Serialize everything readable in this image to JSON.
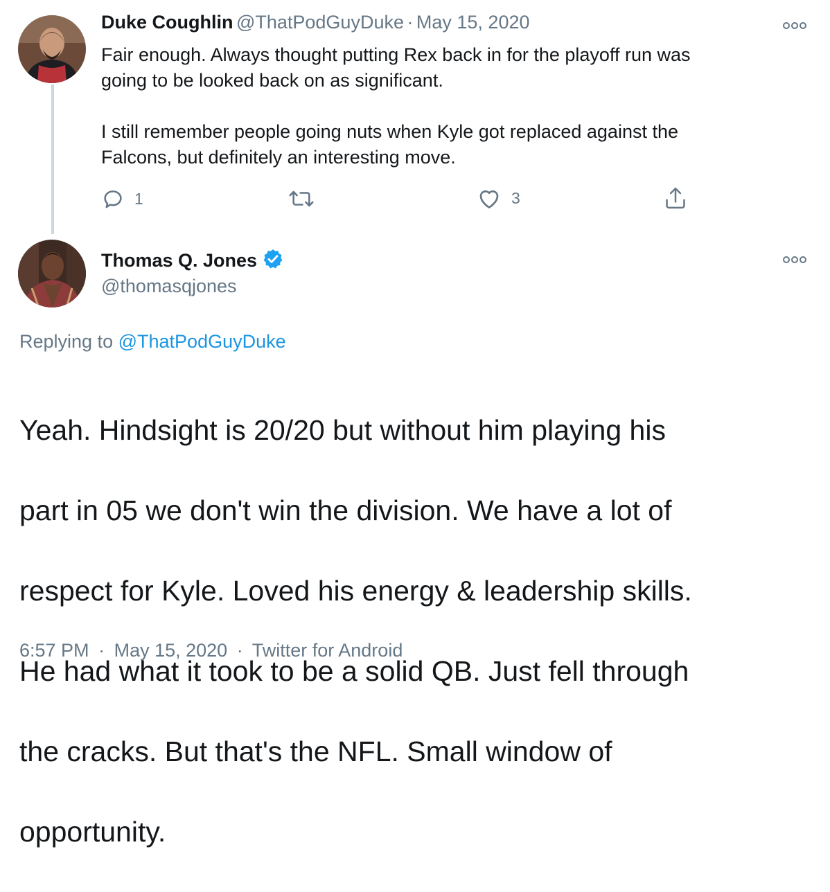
{
  "first_tweet": {
    "display_name": "Duke Coughlin",
    "handle": "@ThatPodGuyDuke",
    "separator": "·",
    "date": "May 15, 2020",
    "text": "Fair enough. Always thought putting Rex back in for the playoff run was going to be looked back on as significant.\n\nI still remember people going nuts when Kyle got replaced against the Falcons, but definitely an interesting move.",
    "line1": "Fair enough. Always thought putting Rex back in for the playoff run was",
    "line2": "going to be looked back on as significant.",
    "line3": "I still remember people going nuts when Kyle got replaced against the",
    "line4": "Falcons, but definitely an interesting move.",
    "reply_count": "1",
    "retweet_count": "",
    "like_count": "3",
    "icons": [
      "reply-icon",
      "retweet-icon",
      "like-icon",
      "share-icon",
      "more-icon"
    ]
  },
  "main_tweet": {
    "display_name": "Thomas Q. Jones",
    "verified": true,
    "handle": "@thomasqjones",
    "replying_prefix": "Replying to",
    "replying_handle": "@ThatPodGuyDuke",
    "text_lines": [
      "Yeah. Hindsight is 20/20 but without him playing his",
      "part in 05 we don't win the division. We have a lot of",
      "respect for Kyle. Loved his energy & leadership skills.",
      "He had what it took to be a solid QB. Just fell through",
      "the cracks. But that's the NFL. Small window of",
      "opportunity."
    ],
    "time": "6:57 PM",
    "separator1": "·",
    "date": "May 15, 2020",
    "separator2": "·",
    "source": "Twitter for Android"
  },
  "colors": {
    "text": "#14171a",
    "muted": "#657786",
    "link": "#1b95e0",
    "verified": "#1da1f2",
    "thread_line": "#ccd6dd"
  }
}
